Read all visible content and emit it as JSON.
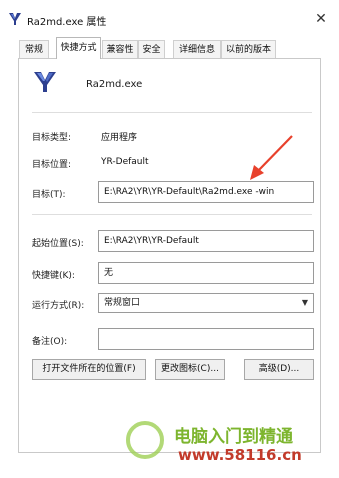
{
  "window": {
    "title": "Ra2md.exe 属性",
    "close_glyph": "✕"
  },
  "tabs": [
    {
      "label": "常规",
      "active": false
    },
    {
      "label": "快捷方式",
      "active": true
    },
    {
      "label": "兼容性",
      "active": false
    },
    {
      "label": "安全",
      "active": false
    },
    {
      "label": "详细信息",
      "active": false
    },
    {
      "label": "以前的版本",
      "active": false
    }
  ],
  "shortcut": {
    "file_name": "Ra2md.exe",
    "target_type_label": "目标类型:",
    "target_type_value": "应用程序",
    "target_location_label": "目标位置:",
    "target_location_value": "YR-Default",
    "target_label": "目标(T):",
    "target_value": "E:\\RA2\\YR\\YR-Default\\Ra2md.exe -win",
    "start_in_label": "起始位置(S):",
    "start_in_value": "E:\\RA2\\YR\\YR-Default",
    "hotkey_label": "快捷键(K):",
    "hotkey_value": "无",
    "run_label": "运行方式(R):",
    "run_value": "常规窗口",
    "comment_label": "备注(O):",
    "comment_value": ""
  },
  "buttons": {
    "open_location": "打开文件所在的位置(F)",
    "change_icon": "更改图标(C)...",
    "advanced": "高级(D)..."
  },
  "watermark": {
    "text": "电脑入门到精通",
    "url": "www.58116.cn"
  },
  "colors": {
    "arrow": "#e8412c",
    "watermark_green": "#7db52e",
    "watermark_red": "#c23a2a"
  },
  "icons": {
    "title_icon": "ra2-app-icon",
    "app_icon": "ra2-app-icon",
    "annotation": "red-arrow"
  }
}
